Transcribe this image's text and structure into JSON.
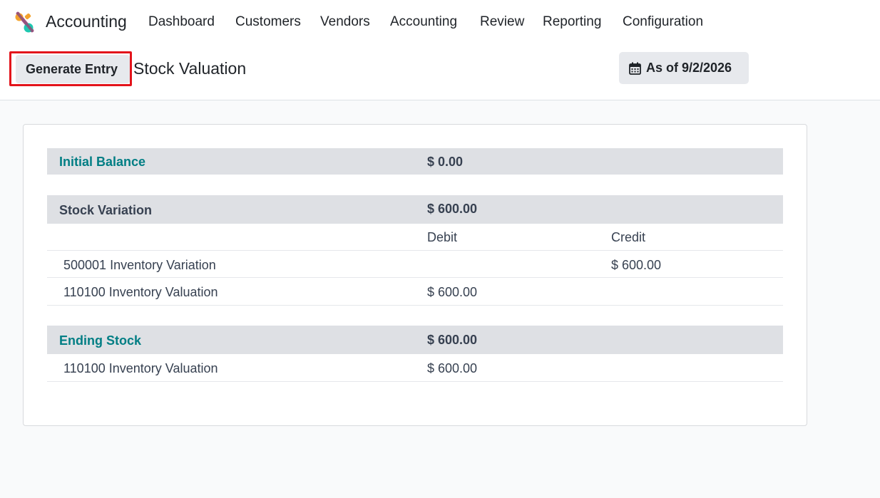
{
  "app": {
    "name": "Accounting",
    "logo_icon": "odoo-accounting-logo",
    "colors": {
      "brand_teal": "#017e84",
      "highlight_red": "#e3131b"
    }
  },
  "nav": {
    "items": [
      "Dashboard",
      "Customers",
      "Vendors",
      "Accounting",
      "Review",
      "Reporting",
      "Configuration"
    ]
  },
  "control_panel": {
    "generate_button": "Generate Entry",
    "title": "Stock Valuation",
    "date_icon": "calendar-icon",
    "date_label": "As of 9/2/2026"
  },
  "report": {
    "initial_balance": {
      "label": "Initial Balance",
      "amount": "$ 0.00"
    },
    "stock_variation": {
      "label": "Stock Variation",
      "amount": "$ 600.00",
      "columns": {
        "debit": "Debit",
        "credit": "Credit"
      },
      "rows": [
        {
          "account": "500001 Inventory Variation",
          "debit": "",
          "credit": "$ 600.00"
        },
        {
          "account": "110100 Inventory Valuation",
          "debit": "$ 600.00",
          "credit": ""
        }
      ]
    },
    "ending_stock": {
      "label": "Ending Stock",
      "amount": "$ 600.00",
      "rows": [
        {
          "account": "110100 Inventory Valuation",
          "debit": "$ 600.00"
        }
      ]
    }
  }
}
